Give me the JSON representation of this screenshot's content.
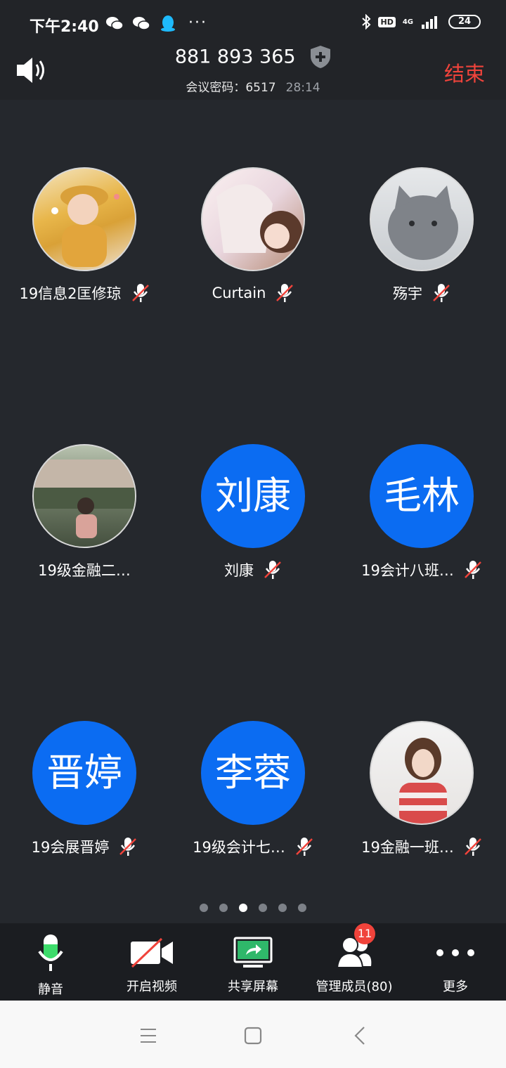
{
  "status_bar": {
    "time": "下午2:40",
    "more": "···",
    "hd": "HD",
    "network": "4G",
    "battery": "24"
  },
  "header": {
    "meeting_id": "881 893 365",
    "password_label": "会议密码：6517",
    "timer": "28:14",
    "end_label": "结束"
  },
  "participants": [
    {
      "name": "19信息2匡修琼",
      "avatar_type": "photo",
      "avatar_text": "",
      "mic_muted": true
    },
    {
      "name": "Curtain",
      "avatar_type": "photo",
      "avatar_text": "",
      "mic_muted": true
    },
    {
      "name": "殇宇",
      "avatar_type": "photo",
      "avatar_text": "",
      "mic_muted": true
    },
    {
      "name": "19级金融二…",
      "avatar_type": "photo",
      "avatar_text": "",
      "mic_muted": false
    },
    {
      "name": "刘康",
      "avatar_type": "initials",
      "avatar_text": "刘康",
      "mic_muted": true
    },
    {
      "name": "19会计八班…",
      "avatar_type": "initials",
      "avatar_text": "毛林",
      "mic_muted": true
    },
    {
      "name": "19会展晋婷",
      "avatar_type": "initials",
      "avatar_text": "晋婷",
      "mic_muted": true
    },
    {
      "name": "19级会计七…",
      "avatar_type": "initials",
      "avatar_text": "李蓉",
      "mic_muted": true
    },
    {
      "name": "19金融一班…",
      "avatar_type": "photo",
      "avatar_text": "",
      "mic_muted": true
    }
  ],
  "pager": {
    "total": 6,
    "active_index": 2
  },
  "toolbar": {
    "mute": "静音",
    "video": "开启视频",
    "share": "共享屏幕",
    "members": "管理成员(80)",
    "members_badge": "11",
    "more": "更多"
  },
  "colors": {
    "accent_blue": "#0b6cf2",
    "end_red": "#f0433b",
    "mic_green": "#3ddc6b",
    "share_green": "#2fb86a"
  }
}
